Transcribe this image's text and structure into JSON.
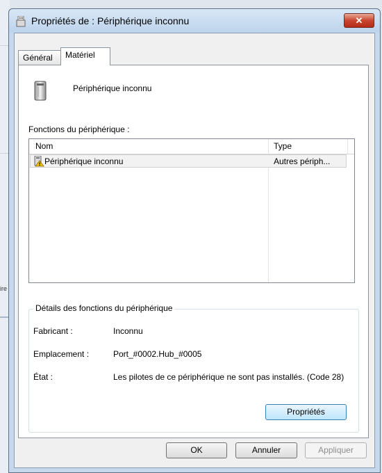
{
  "background": {
    "snippet": "ire"
  },
  "window": {
    "title": "Propriétés de : Périphérique inconnu",
    "close_label": "✕"
  },
  "tabs": [
    {
      "label": "Général",
      "selected": false
    },
    {
      "label": "Matériel",
      "selected": true
    }
  ],
  "device": {
    "name": "Périphérique inconnu"
  },
  "functions": {
    "label": "Fonctions du périphérique :",
    "columns": [
      "Nom",
      "Type"
    ],
    "rows": [
      {
        "name": "Périphérique inconnu",
        "type": "Autres périph...",
        "icon": "unknown-device-warning-icon"
      }
    ]
  },
  "details": {
    "title": "Détails des fonctions du périphérique",
    "manufacturer_label": "Fabricant :",
    "manufacturer_value": "Inconnu",
    "location_label": "Emplacement :",
    "location_value": "Port_#0002.Hub_#0005",
    "status_label": "État :",
    "status_value": "Les pilotes de ce périphérique ne sont pas installés. (Code 28)",
    "properties_button": "Propriétés"
  },
  "footer": {
    "ok": "OK",
    "cancel": "Annuler",
    "apply": "Appliquer"
  },
  "colors": {
    "close_red": "#c8452f",
    "window_frame": "#c6d8ec",
    "selected_button": "#bee6fd"
  }
}
